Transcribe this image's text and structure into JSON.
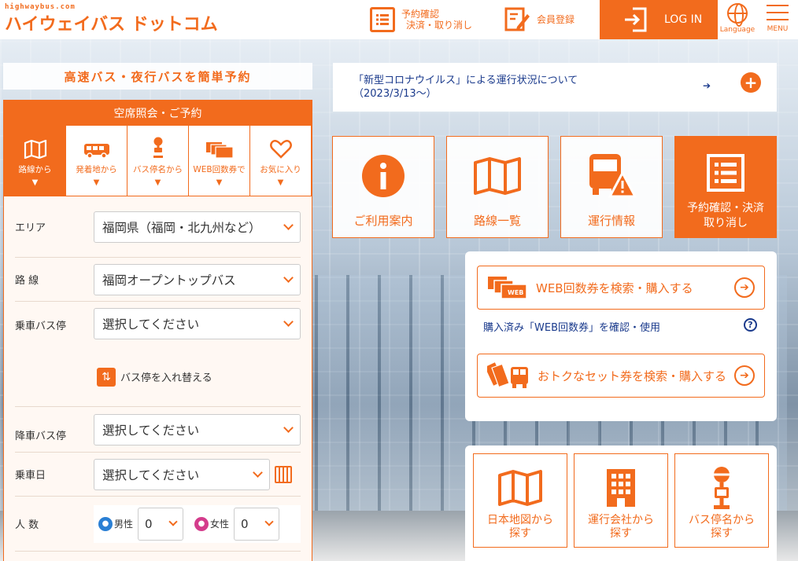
{
  "header": {
    "logo_small": "highwaybus.com",
    "logo_main": "ハイウェイバス ドットコム",
    "reserve_line1": "予約確認",
    "reserve_line2": "決済・取り消し",
    "member": "会員登録",
    "login": "LOG IN",
    "language": "Language",
    "menu": "MENU"
  },
  "tagline": "高速バス・夜行バスを簡単予約",
  "panel": {
    "title": "空席照会・ご予約",
    "tabs": [
      {
        "label": "路線から",
        "icon": "map-icon",
        "active": true
      },
      {
        "label": "発着地から",
        "icon": "bus-icon",
        "active": false
      },
      {
        "label": "バス停名から",
        "icon": "bus-stop-icon",
        "active": false
      },
      {
        "label": "WEB回数券で",
        "icon": "ticket-icon",
        "active": false
      },
      {
        "label": "お気に入り",
        "icon": "heart-icon",
        "active": false
      }
    ],
    "arrow": "▼",
    "area_label": "エリア",
    "area_value": "福岡県（福岡・北九州など）",
    "route_label": "路 線",
    "route_value": "福岡オープントップバス",
    "board_label": "乗車バス停",
    "board_value": "選択してください",
    "swap_label": "バス停を入れ替える",
    "alight_label": "降車バス停",
    "alight_value": "選択してください",
    "date_label": "乗車日",
    "date_value": "選択してください",
    "pax_label": "人 数",
    "male_label": "男性",
    "male_value": "0",
    "female_label": "女性",
    "female_value": "0"
  },
  "news": {
    "text_line1": "「新型コロナウイルス」による運行状況について",
    "text_line2": "（2023/3/13～）",
    "arrow": "➔",
    "plus": "+"
  },
  "tiles": [
    {
      "label": "ご利用案内",
      "icon": "info-icon"
    },
    {
      "label": "路線一覧",
      "icon": "map-icon"
    },
    {
      "label": "運行情報",
      "icon": "bus-alert-icon"
    },
    {
      "label_line1": "予約確認・決済",
      "label_line2": "取り消し",
      "icon": "list-icon"
    }
  ],
  "web": {
    "btn1": "WEB回数券を検索・購入する",
    "link": "購入済み「WEB回数券」を確認・使用",
    "btn2": "おトクなセット券を検索・購入する",
    "web_badge": "WEB"
  },
  "search": [
    {
      "line1": "日本地図から",
      "line2": "探す",
      "icon": "japan-map-icon"
    },
    {
      "line1": "運行会社から",
      "line2": "探す",
      "icon": "building-icon"
    },
    {
      "line1": "バス停名から",
      "line2": "探す",
      "icon": "bus-stop-icon"
    }
  ],
  "colors": {
    "accent": "#f26b1d",
    "link": "#1a3a8c",
    "male": "#2a7fd4",
    "female": "#d43c8c"
  }
}
